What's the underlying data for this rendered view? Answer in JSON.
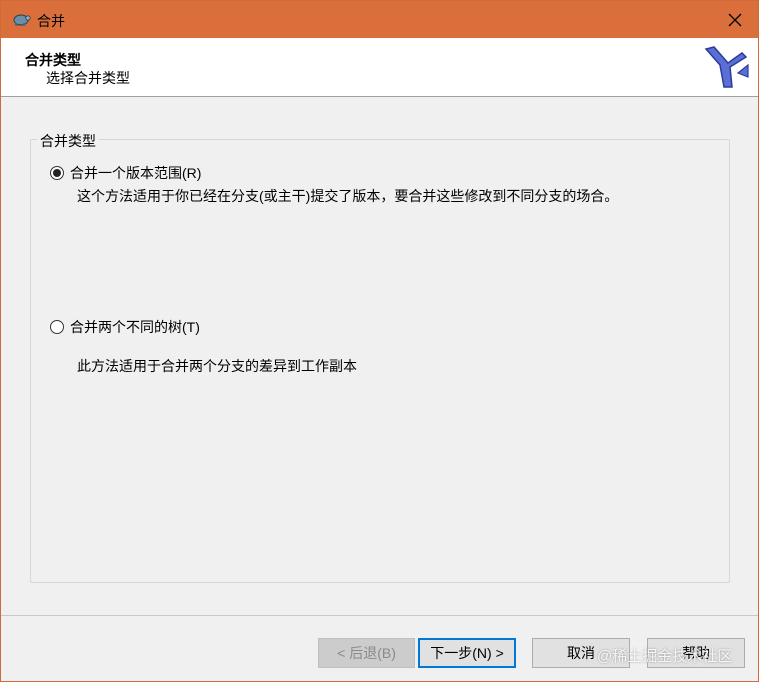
{
  "window": {
    "title": "合并"
  },
  "header": {
    "title": "合并类型",
    "subtitle": "选择合并类型"
  },
  "group": {
    "legend": "合并类型",
    "options": [
      {
        "label": "合并一个版本范围(R)",
        "description": "这个方法适用于你已经在分支(或主干)提交了版本，要合并这些修改到不同分支的场合。",
        "selected": true
      },
      {
        "label": "合并两个不同的树(T)",
        "description": "此方法适用于合并两个分支的差异到工作副本",
        "selected": false
      }
    ]
  },
  "buttons": {
    "back": "< 后退(B)",
    "next": "下一步(N) >",
    "cancel": "取消",
    "help": "帮助"
  },
  "watermark": "@稀土掘金技术社区"
}
